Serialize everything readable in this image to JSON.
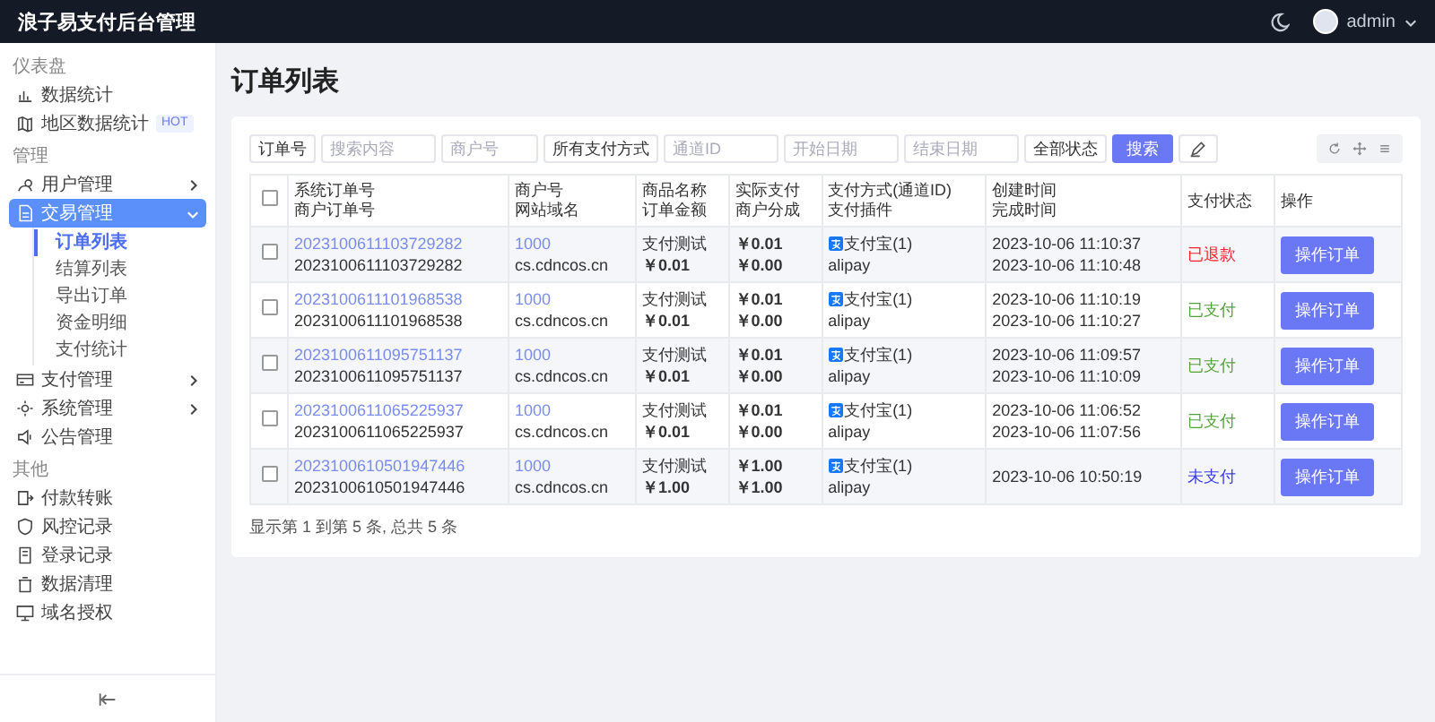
{
  "header": {
    "title": "浪子易支付后台管理",
    "user": "admin"
  },
  "sidebar": {
    "groups": [
      {
        "title": "仪表盘",
        "items": [
          {
            "label": "数据统计",
            "selected": false
          },
          {
            "label": "地区数据统计",
            "badge": "HOT",
            "selected": false
          }
        ]
      },
      {
        "title": "管理",
        "items": [
          {
            "label": "用户管理",
            "selected": false,
            "expanded": false
          },
          {
            "label": "交易管理",
            "selected": true,
            "expanded": true,
            "children": [
              {
                "label": "订单列表",
                "selected": true
              },
              {
                "label": "结算列表",
                "selected": false
              },
              {
                "label": "导出订单",
                "selected": false
              },
              {
                "label": "资金明细",
                "selected": false
              },
              {
                "label": "支付统计",
                "selected": false
              }
            ]
          },
          {
            "label": "支付管理",
            "selected": false,
            "expanded": false
          },
          {
            "label": "系统管理",
            "selected": false,
            "expanded": false
          },
          {
            "label": "公告管理",
            "selected": false
          }
        ]
      },
      {
        "title": "其他",
        "items": [
          {
            "label": "付款转账",
            "selected": false
          },
          {
            "label": "风控记录",
            "selected": false
          },
          {
            "label": "登录记录",
            "selected": false
          },
          {
            "label": "数据清理",
            "selected": false
          },
          {
            "label": "域名授权",
            "selected": false
          }
        ]
      }
    ]
  },
  "page_title": "订单列表",
  "filters": [
    {
      "kind": "select",
      "value": "订单号"
    },
    {
      "kind": "input",
      "placeholder": "搜索内容"
    },
    {
      "kind": "input",
      "placeholder": "商户号"
    },
    {
      "kind": "select",
      "value": "所有支付方式"
    },
    {
      "kind": "input",
      "placeholder": "通道ID"
    },
    {
      "kind": "input",
      "placeholder": "开始日期"
    },
    {
      "kind": "input",
      "placeholder": "结束日期"
    },
    {
      "kind": "select",
      "value": "全部状态"
    }
  ],
  "search_button": "搜索",
  "table": {
    "all_checked": false,
    "columns": [
      [
        "系统订单号",
        "商户订单号"
      ],
      [
        "商户号",
        "网站域名"
      ],
      [
        "商品名称",
        "订单金额"
      ],
      [
        "实际支付",
        "商户分成"
      ],
      [
        "支付方式(通道ID)",
        "支付插件"
      ],
      [
        "创建时间",
        "完成时间"
      ],
      [
        "支付状态"
      ],
      [
        "操作"
      ]
    ],
    "rows": [
      {
        "checked": false,
        "trade_no": "2023100611103729282",
        "out_trade_no": "2023100611103729282",
        "merchant": "1000",
        "domain": "cs.cdncos.cn",
        "product": "支付测试",
        "amount": "￥0.01",
        "paid": "￥0.01",
        "share": "￥0.00",
        "channel": "支付宝(1)",
        "plugin": "alipay",
        "created": "2023-10-06 11:10:37",
        "completed": "2023-10-06 11:10:48",
        "status": "已退款",
        "color": "#f5222d",
        "action": "操作订单"
      },
      {
        "checked": false,
        "trade_no": "2023100611101968538",
        "out_trade_no": "2023100611101968538",
        "merchant": "1000",
        "domain": "cs.cdncos.cn",
        "product": "支付测试",
        "amount": "￥0.01",
        "paid": "￥0.01",
        "share": "￥0.00",
        "channel": "支付宝(1)",
        "plugin": "alipay",
        "created": "2023-10-06 11:10:19",
        "completed": "2023-10-06 11:10:27",
        "status": "已支付",
        "color": "#52a43a",
        "action": "操作订单"
      },
      {
        "checked": false,
        "trade_no": "2023100611095751137",
        "out_trade_no": "2023100611095751137",
        "merchant": "1000",
        "domain": "cs.cdncos.cn",
        "product": "支付测试",
        "amount": "￥0.01",
        "paid": "￥0.01",
        "share": "￥0.00",
        "channel": "支付宝(1)",
        "plugin": "alipay",
        "created": "2023-10-06 11:09:57",
        "completed": "2023-10-06 11:10:09",
        "status": "已支付",
        "color": "#52a43a",
        "action": "操作订单"
      },
      {
        "checked": false,
        "trade_no": "2023100611065225937",
        "out_trade_no": "2023100611065225937",
        "merchant": "1000",
        "domain": "cs.cdncos.cn",
        "product": "支付测试",
        "amount": "￥0.01",
        "paid": "￥0.01",
        "share": "￥0.00",
        "channel": "支付宝(1)",
        "plugin": "alipay",
        "created": "2023-10-06 11:06:52",
        "completed": "2023-10-06 11:07:56",
        "status": "已支付",
        "color": "#52a43a",
        "action": "操作订单"
      },
      {
        "checked": false,
        "trade_no": "2023100610501947446",
        "out_trade_no": "2023100610501947446",
        "merchant": "1000",
        "domain": "cs.cdncos.cn",
        "product": "支付测试",
        "amount": "￥1.00",
        "paid": "￥1.00",
        "share": "￥1.00",
        "channel": "支付宝(1)",
        "plugin": "alipay",
        "created": "2023-10-06 10:50:19",
        "status": "未支付",
        "color": "#3a3af0",
        "action": "操作订单"
      }
    ]
  },
  "pagination": "显示第 1 到第 5 条, 总共 5 条"
}
